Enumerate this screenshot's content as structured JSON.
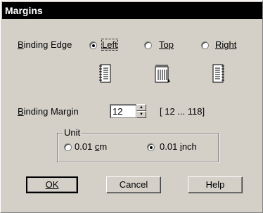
{
  "window": {
    "title": "Margins"
  },
  "binding_edge": {
    "label": "Binding Edge",
    "options": [
      {
        "label": "Left",
        "checked": true
      },
      {
        "label": "Top",
        "checked": false
      },
      {
        "label": "Right",
        "checked": false
      }
    ]
  },
  "binding_margin": {
    "label": "Binding Margin",
    "value": "12",
    "range": "[ 12 ... 118]"
  },
  "unit": {
    "label": "Unit",
    "options": [
      {
        "label": "0.01 cm",
        "checked": false
      },
      {
        "label": "0.01 inch",
        "checked": true
      }
    ]
  },
  "buttons": {
    "ok": "OK",
    "cancel": "Cancel",
    "help": "Help"
  }
}
